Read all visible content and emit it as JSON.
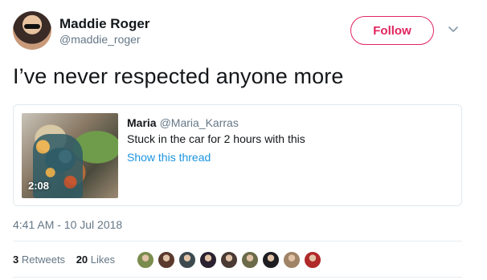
{
  "author": {
    "display_name": "Maddie Roger",
    "handle": "@maddie_roger",
    "avatar_icon": "profile-photo"
  },
  "follow_label": "Follow",
  "menu_icon": "chevron-down-icon",
  "tweet_text": "I’ve never respected anyone more",
  "quote": {
    "name": "Maria",
    "handle": "@Maria_Karras",
    "text": "Stuck in the car for 2 hours with this",
    "thread_link": "Show this thread",
    "video_duration": "2:08"
  },
  "timestamp": "4:41 AM - 10 Jul 2018",
  "stats": {
    "retweets_count": "3",
    "retweets_label": "Retweets",
    "likes_count": "20",
    "likes_label": "Likes"
  },
  "likers": [
    {
      "name": "liker-avatar-1",
      "color": "#7a8c4e"
    },
    {
      "name": "liker-avatar-2",
      "color": "#5b3a2e"
    },
    {
      "name": "liker-avatar-3",
      "color": "#3c4a4f"
    },
    {
      "name": "liker-avatar-4",
      "color": "#2a2230"
    },
    {
      "name": "liker-avatar-5",
      "color": "#4a3a33"
    },
    {
      "name": "liker-avatar-6",
      "color": "#6b6b4a"
    },
    {
      "name": "liker-avatar-7",
      "color": "#1e1e22"
    },
    {
      "name": "liker-avatar-8",
      "color": "#a08466"
    },
    {
      "name": "liker-avatar-9",
      "color": "#b02a2a"
    }
  ],
  "colors": {
    "follow_accent": "#e0245e",
    "link": "#1b95e0",
    "secondary_text": "#657786"
  }
}
